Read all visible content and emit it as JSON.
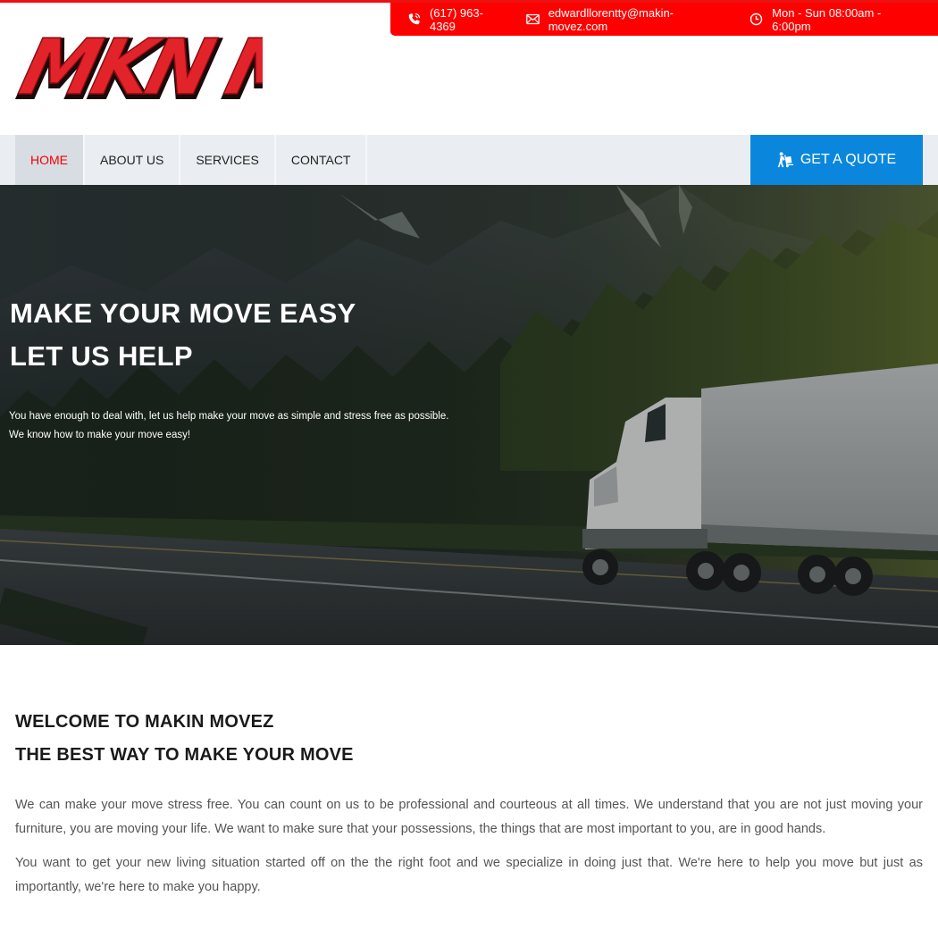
{
  "contact_bar": {
    "phone": "(617) 963-4369",
    "email": "edwardllorentty@makin-movez.com",
    "hours": "Mon - Sun 08:00am - 6:00pm",
    "phone_icon": "phone-icon",
    "email_icon": "envelope-icon",
    "hours_icon": "clock-icon",
    "color": "#ff0000"
  },
  "logo": {
    "text": "MKN MVZ"
  },
  "nav": {
    "items": [
      {
        "label": "HOME",
        "active": true
      },
      {
        "label": "ABOUT US",
        "active": false
      },
      {
        "label": "SERVICES",
        "active": false
      },
      {
        "label": "CONTACT",
        "active": false
      }
    ],
    "quote_label": "GET A QUOTE",
    "quote_icon": "mover-dolly-icon",
    "quote_color": "#0a87dd",
    "active_color": "#f00000"
  },
  "hero": {
    "title_line1": "MAKE YOUR MOVE EASY",
    "title_line2": "LET US HELP",
    "text_line1": "You have enough to deal with, let us help make your move as simple and stress free as possible.",
    "text_line2": "We know how to make your move easy!"
  },
  "welcome": {
    "heading1": "WELCOME TO MAKIN MOVEZ",
    "heading2": "THE BEST WAY TO MAKE YOUR MOVE",
    "paragraph1": "We can make your move stress free. You can count on us to be professional and courteous at all times. We understand that you are not just moving your furniture, you are moving your life. We want to make sure that your possessions, the things that are most important to you, are in good hands.",
    "paragraph2": "You want to get your new living situation started off on the the right foot and we specialize in doing just that. We're here to help you move but just as importantly, we're here to make you happy."
  }
}
